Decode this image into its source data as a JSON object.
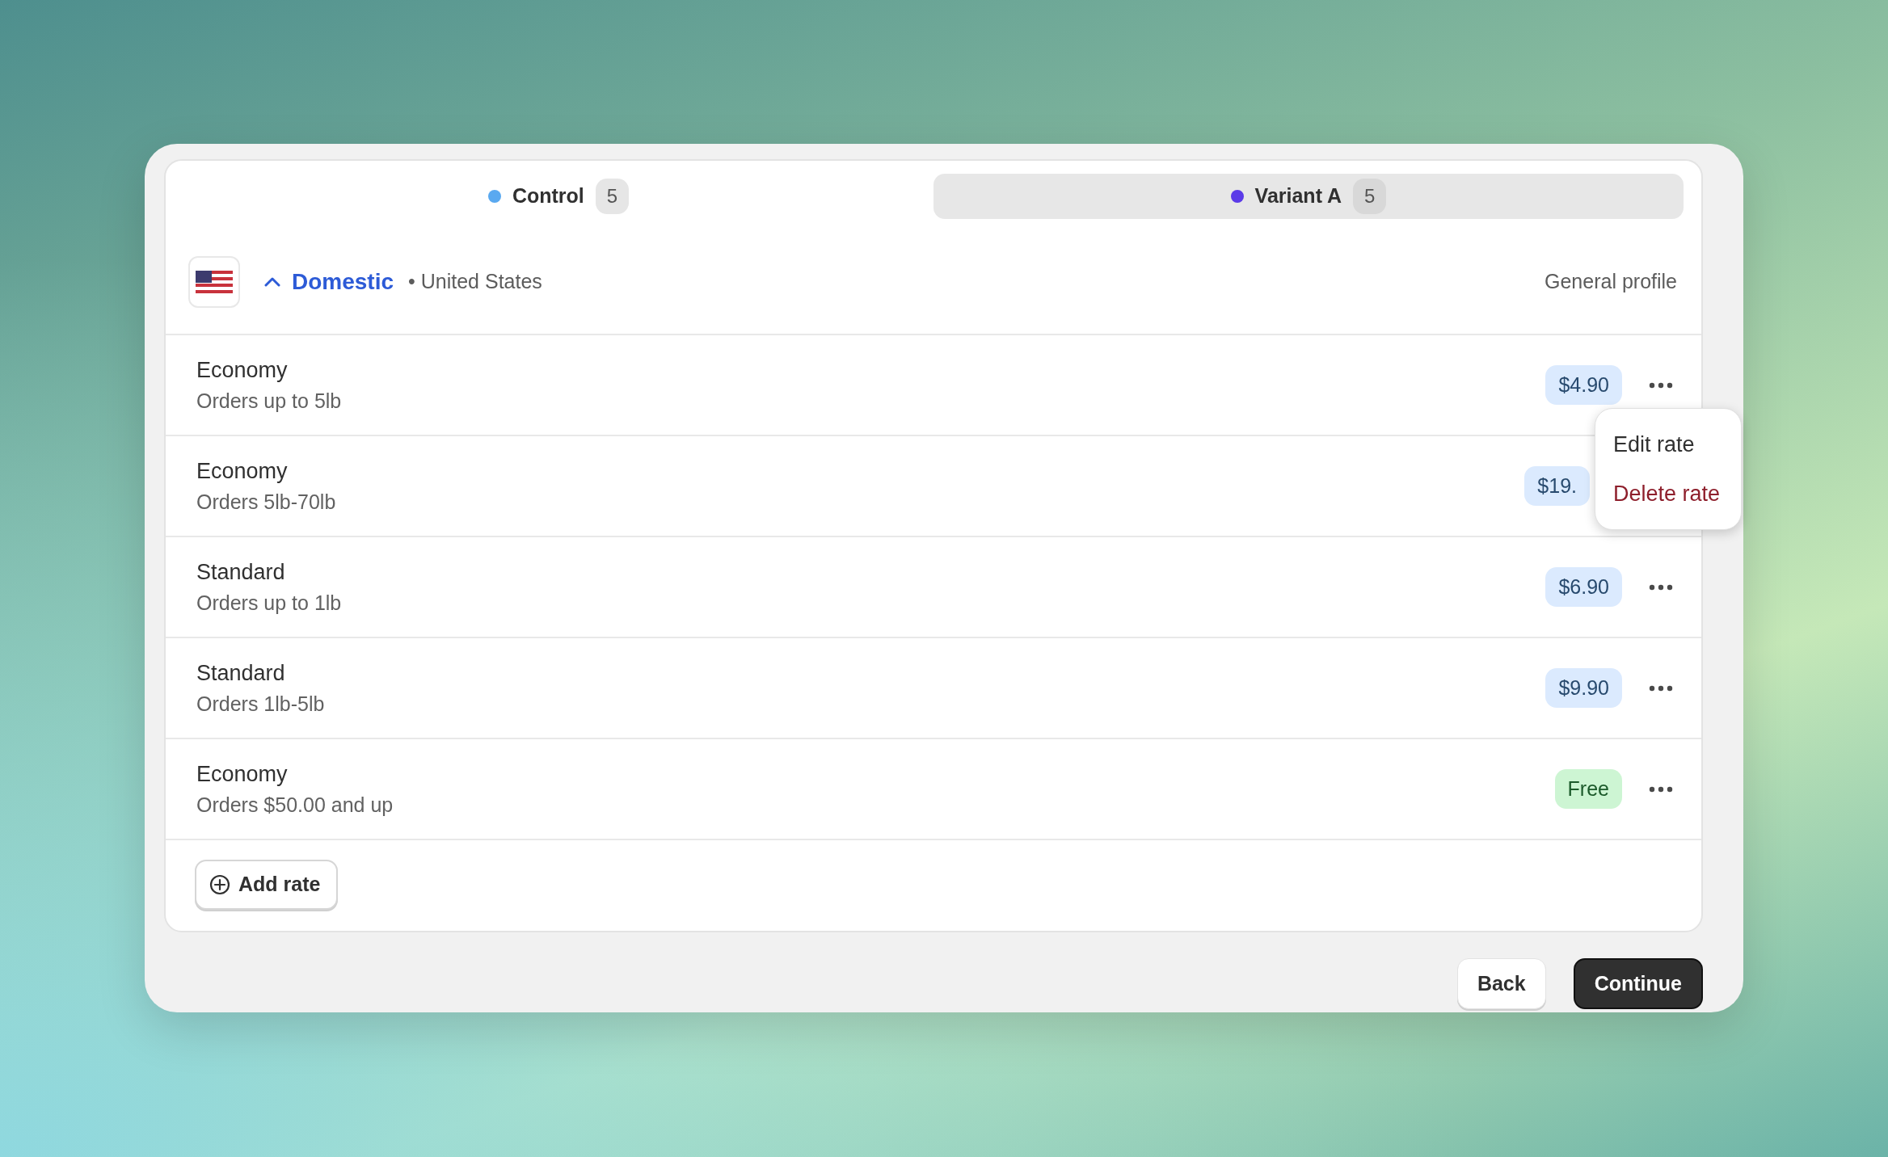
{
  "tabs": [
    {
      "label": "Control",
      "count": "5",
      "color": "#5aa9f0",
      "selected": false
    },
    {
      "label": "Variant A",
      "count": "5",
      "color": "#5b3be8",
      "selected": true
    }
  ],
  "zone": {
    "name": "Domestic",
    "expanded": true,
    "separator": "•",
    "region": "United States",
    "profile": "General profile"
  },
  "rates": [
    {
      "name": "Economy",
      "condition": "Orders up to 5lb",
      "price": "$4.90",
      "kind": "paid",
      "menu_button": true,
      "menu": [
        {
          "label": "Edit rate",
          "kind": "normal"
        },
        {
          "label": "Delete rate",
          "kind": "danger"
        }
      ]
    },
    {
      "name": "Economy",
      "condition": "Orders 5lb-70lb",
      "price": "$19.",
      "kind": "paid",
      "menu_button": false
    },
    {
      "name": "Standard",
      "condition": "Orders up to 1lb",
      "price": "$6.90",
      "kind": "paid",
      "menu_button": true
    },
    {
      "name": "Standard",
      "condition": "Orders 1lb-5lb",
      "price": "$9.90",
      "kind": "paid",
      "menu_button": true
    },
    {
      "name": "Economy",
      "condition": "Orders $50.00 and up",
      "price": "Free",
      "kind": "free",
      "menu_button": true
    }
  ],
  "add_button": "Add rate",
  "footer": {
    "back": "Back",
    "continue": "Continue"
  }
}
